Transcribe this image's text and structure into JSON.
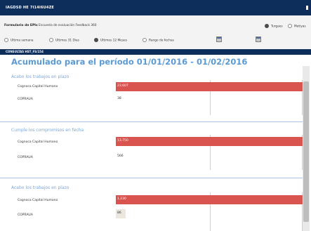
{
  "header": {
    "title": "IAGDSD HE 7I14I6U4ZE"
  },
  "filters": {
    "form_label": "Formulario de EPIs",
    "form_value": "Encuesta de evaluación Feedback 360",
    "view_options": [
      {
        "label": "Turgaes",
        "checked": true
      },
      {
        "label": "Metiyas",
        "checked": false
      }
    ],
    "periods": [
      {
        "label": "Ultima semana",
        "checked": false
      },
      {
        "label": "Ultimos 31 Dias",
        "checked": false
      },
      {
        "label": "Ultimos 12 Meses",
        "checked": true
      },
      {
        "label": "Rango de fechas",
        "checked": false
      }
    ]
  },
  "subheader": {
    "label": "CONSULTAS HST_FS/154"
  },
  "main": {
    "title": "Acumulado para el período 01/01/2016 - 01/02/2016",
    "sections": [
      {
        "title": "Acabo los trabajos en plazo",
        "rows": [
          {
            "label": "Cognoca Capital Humano",
            "value": "23.607"
          },
          {
            "label": "COPRAUA",
            "value": "38"
          }
        ]
      },
      {
        "title": "Cumple los compromisos en fecha",
        "rows": [
          {
            "label": "Cognoca Capital Humano",
            "value": "13.750"
          },
          {
            "label": "COPRAUA",
            "value": "566"
          }
        ]
      },
      {
        "title": "Acabo los trabajos en plazo",
        "rows": [
          {
            "label": "Cognoca Capital Humano",
            "value": "1.230"
          },
          {
            "label": "COPRAUA",
            "value": "86"
          }
        ]
      }
    ]
  },
  "colors": {
    "header_bg": "#0d2d5a",
    "accent_title": "#5b9bd5",
    "bar_red": "#d9534f"
  }
}
